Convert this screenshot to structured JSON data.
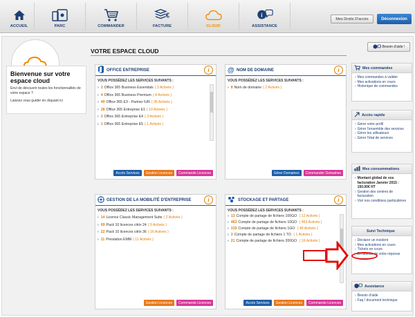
{
  "nav": [
    {
      "label": "ACCUEIL",
      "icon": "home-icon",
      "active": false
    },
    {
      "label": "PARC",
      "icon": "devices-icon",
      "active": false
    },
    {
      "label": "COMMANDER",
      "icon": "cart-icon",
      "active": false
    },
    {
      "label": "FACTURE",
      "icon": "invoice-icon",
      "active": false
    },
    {
      "label": "CLOUD",
      "icon": "cloud-icon",
      "active": true
    },
    {
      "label": "ASSISTANCE",
      "icon": "assistance-icon",
      "active": false
    }
  ],
  "header": {
    "droits": "Mes Droits D'accès",
    "deconnexion": "Déconnexion"
  },
  "welcome": {
    "title": "Bienvenue sur votre espace cloud",
    "text1": "Envi de découvrir toutes les fonctionnalités de votre espace ?",
    "text2": "Laissez vous guider en cliquant ici"
  },
  "page": {
    "title": "VOTRE ESPACE CLOUD",
    "help": "Besoin d'aide !"
  },
  "panels": {
    "office": {
      "title": "OFFICE ENTREPRISE",
      "subtitle": "VOUS POSSÉDEZ LES SERVICES SUIVANTS :",
      "items": [
        {
          "num": "3",
          "name": "Office 365 Business Essentials",
          "active": "( 3 Activés )"
        },
        {
          "num": "4",
          "name": "Office 365 Business Premium",
          "active": "( 4 Activés )"
        },
        {
          "num": "49",
          "name": "Office 365 E3 - Partner IUR",
          "active": "( 36 Activés )"
        },
        {
          "num": "28",
          "name": "Office 365 Entreprise E1",
          "active": "( 10 Activés )"
        },
        {
          "num": "3",
          "name": "Office 365 Entreprise E4",
          "active": "( 3 Activés )"
        },
        {
          "num": "1",
          "name": "Office 365 Entreprise E5",
          "active": "( 1 Activés )"
        }
      ],
      "btn1": "Accès Services",
      "btn2": "Gestion Licences",
      "btn3": "Commande Licences"
    },
    "domaine": {
      "title": "NOM DE DOMAINE",
      "subtitle": "VOUS POSSÉDEZ LES SERVICES SUIVANTS :",
      "items": [
        {
          "num": "8",
          "name": "Nom de domaine",
          "active": "( 2 Activés )"
        }
      ],
      "btn1": "Gérer Domaines",
      "btn2": "Commander Domaines"
    },
    "mobilite": {
      "title": "GESTION DE LA MOBILITÉ D'ENTREPRISE",
      "subtitle": "VOUS POSSÉDEZ LES SERVICES SUIVANTS :",
      "items": [
        {
          "num": "14",
          "name": "Licence Classic Management Suite",
          "active": "( 2 Activés )"
        },
        {
          "num": "69",
          "name": "Pack 10 licences citrix 24",
          "active": "( 9 Activés )"
        },
        {
          "num": "22",
          "name": "Pack 10 licences citrix 36",
          "active": "( 16 Activés )"
        },
        {
          "num": "11",
          "name": "Prestation EMM",
          "active": "( 11 Activés )"
        }
      ],
      "btn1": "Gestion Licences",
      "btn2": "Commande Licences"
    },
    "stockage": {
      "title": "STOCKAGE ET PARTAGE",
      "subtitle": "VOUS POSSÉDEZ LES SERVICES SUIVANTS :",
      "items": [
        {
          "num": "13",
          "name": "Compte de partage de fichiers 100GO",
          "active": "( 12 Activés )"
        },
        {
          "num": "463",
          "name": "Compte de partage de fichiers 10GO",
          "active": "( 463 Activés )"
        },
        {
          "num": "319",
          "name": "Compte de partage de fichiers 1GO",
          "active": "( 48 Activés )"
        },
        {
          "num": "3",
          "name": "Compte de partage de fichiers 1 TO",
          "active": "( 1 Activés )"
        },
        {
          "num": "21",
          "name": "Compte de partage de fichiers 200GO",
          "active": "( 16 Activés )"
        }
      ],
      "btn1": "Accès Services",
      "btn2": "Gestion Licences",
      "btn3": "Commande Licences"
    }
  },
  "sidebar": {
    "commandes": {
      "title": "Mes commandes",
      "items": [
        "Mes commandes à valider",
        "Mes activations en cours",
        "Historique de commandes"
      ]
    },
    "rapide": {
      "title": "Accès rapide",
      "items": [
        "Gérer votre profil",
        "Gérer l'ensemble des services",
        "Gérer les utilisateurs",
        "Gérer l'état de services"
      ]
    },
    "conso": {
      "title": "Mes consommations",
      "highlight": "Montant global de vos facturation Janvier 2015 : 150.00€ HT",
      "items": [
        "Gestion des centres de facturation",
        "Voir nos conditions particulières"
      ]
    },
    "suivi": {
      "title": "Suivi Technique",
      "items": [
        "Déclarer un incident",
        "Mes activations en cours",
        "Tickets en cours",
        "En attente de votre réponse"
      ]
    },
    "assistance": {
      "title": "Assistance",
      "items": [
        "Besoin d'aide",
        "Faq / document technique"
      ]
    }
  },
  "colors": {
    "navy": "#1d3f73",
    "blue": "#1d5ea8",
    "orange": "#e07b00",
    "pink": "#d8379a",
    "annotation": "#e01010"
  }
}
